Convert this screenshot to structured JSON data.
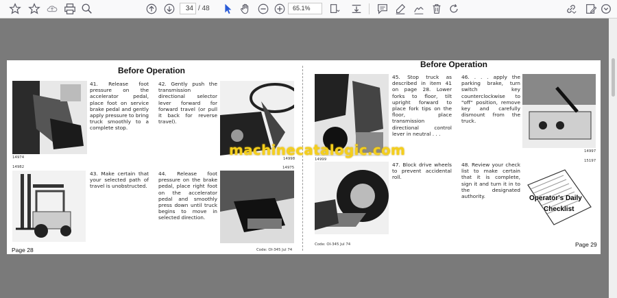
{
  "toolbar": {
    "current_page": "34",
    "page_total": "/ 48",
    "zoom": "65.1%",
    "icons": [
      "star-icon",
      "bookmark-icon",
      "cloud-icon",
      "print-icon",
      "search-icon",
      "page-up-icon",
      "page-down-icon",
      "pointer-icon",
      "hand-icon",
      "zoom-out-icon",
      "zoom-in-icon",
      "fit-page-icon",
      "fit-width-icon",
      "comment-icon",
      "highlight-icon",
      "sign-icon",
      "delete-icon",
      "rotate-icon",
      "link-icon",
      "settings-icon"
    ]
  },
  "left_page": {
    "heading": "Before Operation",
    "item41": "41. Release foot pressure on the accelerator pedal, place foot on service brake pedal and gently apply pressure to bring truck smoothly to a complete stop.",
    "item42": "42. Gently push the transmission directional selector lever forward for forward travel (or pull it back for reverse travel).",
    "item43": "43. Make certain that your selected path of travel is unobstructed.",
    "item44": "44. Release foot pressure on the brake pedal, place right foot on the accelerator pedal and smoothly press down until truck begins to move in selected direction.",
    "fig1": "14974",
    "fig2": "14998",
    "fig3": "14982",
    "fig4": "14975",
    "page_number": "Page 28",
    "code": "Code: OI-345 Jul 74"
  },
  "right_page": {
    "heading": "Before Operation",
    "item45": "45. Stop truck as described in item 41 on page 28. Lower forks to floor, tilt upright forward to place fork tips on the floor, place transmission directional control lever in neutral . . .",
    "item46": "46. . . . apply the parking brake, turn switch key counterclockwise to \"off\" position, remove key and carefully dismount from the truck.",
    "item47": "47. Block drive wheels to prevent accidental roll.",
    "item48": "48. Review your check list to make certain that it is complete, sign it and turn it in to the designated authority.",
    "checklist_line1": "Operator's Daily",
    "checklist_line2": "Checklist",
    "fig1": "14999",
    "fig2": "14997",
    "fig3": "15197",
    "page_number": "Page 29",
    "code": "Code: OI-345 Jul 74"
  },
  "watermark": "machinecatalogic.com"
}
